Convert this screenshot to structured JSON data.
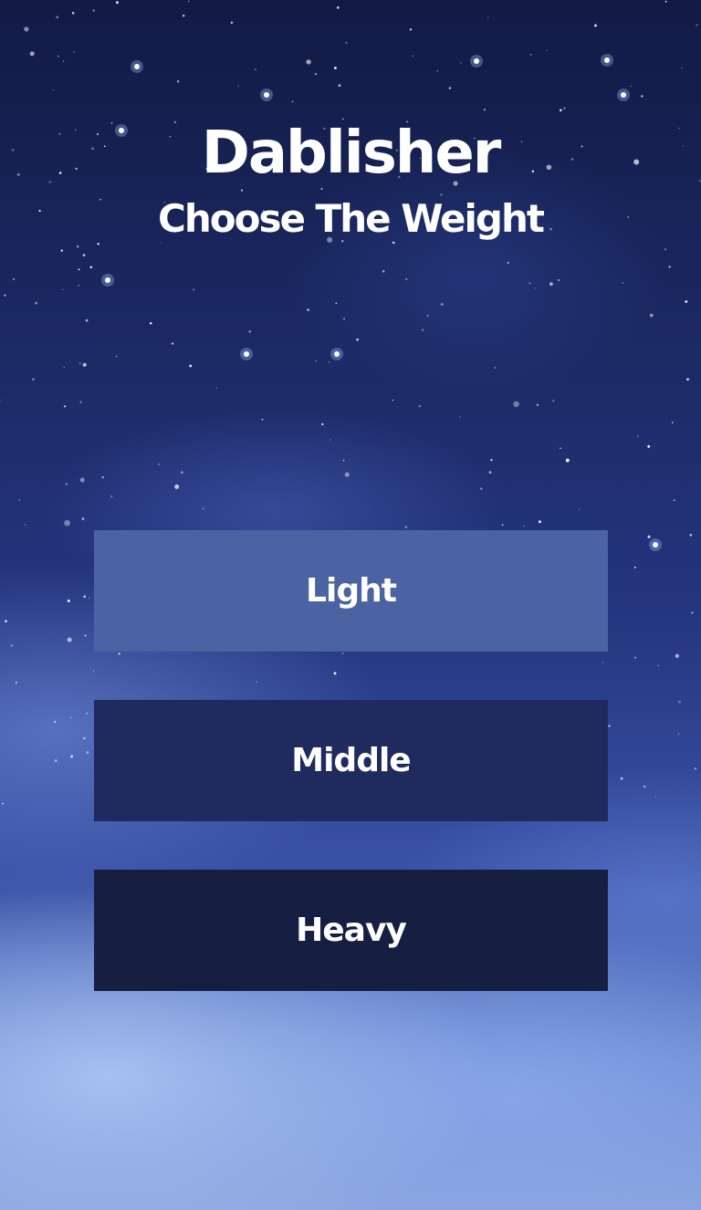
{
  "app": {
    "title": "Dablisher",
    "subtitle": "Choose The Weight"
  },
  "options": [
    {
      "label": "Light",
      "color": "#4a64a3"
    },
    {
      "label": "Middle",
      "color": "#1f2a5f"
    },
    {
      "label": "Heavy",
      "color": "#161e42"
    }
  ],
  "theme": {
    "background": "night-sky-with-clouds",
    "text_color": "#ffffff"
  }
}
